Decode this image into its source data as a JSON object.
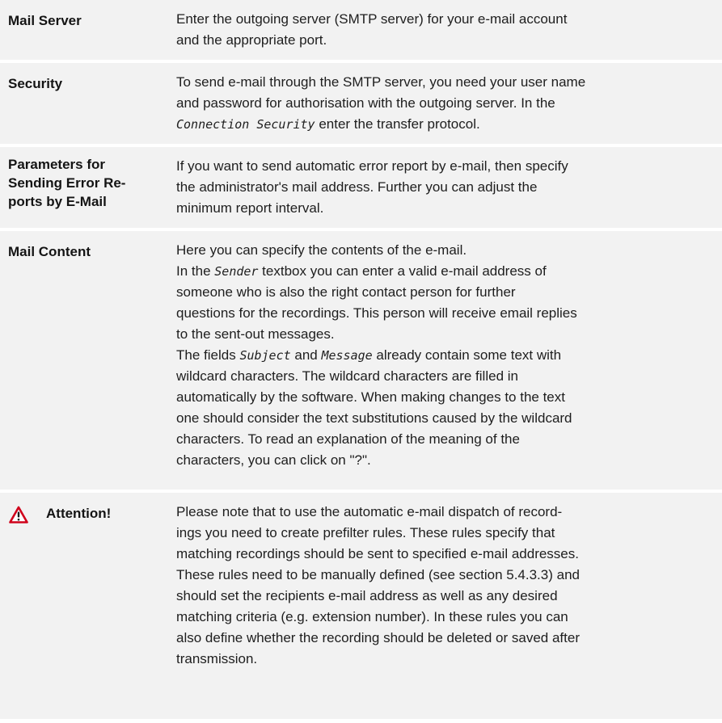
{
  "rows": [
    {
      "term": "Mail Server",
      "lines": [
        "Enter the outgoing server (SMTP server) for your e-mail account",
        "and the appropriate port."
      ]
    },
    {
      "term": "Security",
      "lines": [
        "To send e-mail through the SMTP server, you need your user name",
        "and password for authorisation with the outgoing server. In the"
      ],
      "line3": {
        "field": "Connection Security",
        "suffix": " enter the transfer protocol."
      }
    },
    {
      "term_lines": [
        "Parameters for",
        "Sending Error Re-",
        "ports by E-Mail"
      ],
      "lines": [
        "If you want to send automatic error report by e-mail, then specify",
        "the administrator's mail address. Further you can adjust the",
        "minimum report interval."
      ]
    },
    {
      "term": "Mail Content",
      "line1": "Here you can specify the contents of the e-mail.",
      "line2": {
        "prefix": "In the ",
        "field": "Sender",
        "suffix": " textbox you can enter a valid e-mail address of"
      },
      "lines_a": [
        "someone who is also the right contact person for further",
        "questions for the recordings. This person will receive email replies",
        "to the sent-out messages."
      ],
      "line6": {
        "prefix": "The fields ",
        "field1": "Subject",
        "middle": " and ",
        "field2": "Message",
        "suffix": " already contain some text with"
      },
      "lines_b": [
        "wildcard characters. The wildcard characters are filled in",
        "automatically by the software. When making changes to the text",
        "one should consider the text substitutions caused by the wildcard",
        "characters. To read an explanation of the meaning of the",
        "characters, you can click on \"?\"."
      ]
    },
    {
      "term": "Attention!",
      "icon": "warning-triangle-icon",
      "icon_color": "#d0021b",
      "lines": [
        "Please note that to use the automatic e-mail dispatch of record-",
        "ings you need to create prefilter rules. These rules specify that",
        "matching recordings should be sent to specified e-mail addresses.",
        "These rules need to be manually defined (see section 5.4.3.3) and",
        "should set the recipients e-mail address as well as any desired",
        "matching criteria (e.g. extension number). In these rules you can",
        "also define whether the recording should be deleted or saved after",
        "transmission."
      ]
    }
  ]
}
